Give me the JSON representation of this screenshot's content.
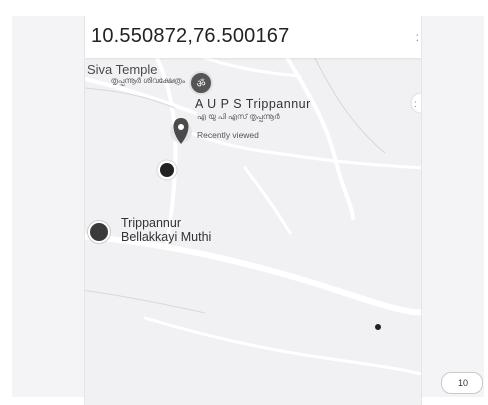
{
  "search": {
    "query": "10.550872,76.500167",
    "overflow": ":"
  },
  "map": {
    "places": [
      {
        "name": "r Siva Temple",
        "local_name": "തൃപ്പന്നൂർ ശിവക്ഷേത്രം",
        "icon": "om-icon"
      },
      {
        "name": "A U P S Trippannur",
        "local_name": "എ യു പി എസ് തൃപ്പന്നൂർ",
        "note": "Recently viewed",
        "icon": "map-pin-icon"
      },
      {
        "name_line1": "Trippannur",
        "name_line2": "Bellakkayi Muthi",
        "icon": "bell-icon"
      }
    ],
    "markers": [
      "current-location-icon",
      "small-dot-icon"
    ],
    "right_edge_glyph": ":"
  },
  "pager": {
    "label": "10"
  }
}
